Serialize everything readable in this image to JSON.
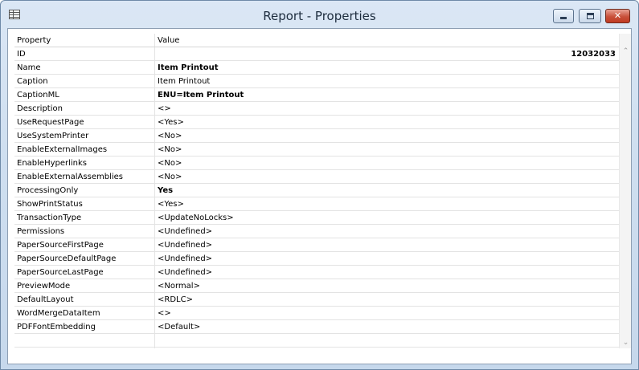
{
  "window": {
    "title": "Report - Properties",
    "minimize_glyph": "",
    "close_glyph": "✕"
  },
  "grid": {
    "headers": {
      "property": "Property",
      "value": "Value"
    },
    "rows": [
      {
        "property": "ID",
        "value": "12032033",
        "bold": true,
        "align": "right"
      },
      {
        "property": "Name",
        "value": "Item Printout",
        "bold": true
      },
      {
        "property": "Caption",
        "value": "Item Printout",
        "bold": false
      },
      {
        "property": "CaptionML",
        "value": "ENU=Item Printout",
        "bold": true
      },
      {
        "property": "Description",
        "value": "<>",
        "bold": false
      },
      {
        "property": "UseRequestPage",
        "value": "<Yes>",
        "bold": false
      },
      {
        "property": "UseSystemPrinter",
        "value": "<No>",
        "bold": false
      },
      {
        "property": "EnableExternalImages",
        "value": "<No>",
        "bold": false
      },
      {
        "property": "EnableHyperlinks",
        "value": "<No>",
        "bold": false
      },
      {
        "property": "EnableExternalAssemblies",
        "value": "<No>",
        "bold": false
      },
      {
        "property": "ProcessingOnly",
        "value": "Yes",
        "bold": true
      },
      {
        "property": "ShowPrintStatus",
        "value": "<Yes>",
        "bold": false
      },
      {
        "property": "TransactionType",
        "value": "<UpdateNoLocks>",
        "bold": false
      },
      {
        "property": "Permissions",
        "value": "<Undefined>",
        "bold": false
      },
      {
        "property": "PaperSourceFirstPage",
        "value": "<Undefined>",
        "bold": false
      },
      {
        "property": "PaperSourceDefaultPage",
        "value": "<Undefined>",
        "bold": false
      },
      {
        "property": "PaperSourceLastPage",
        "value": "<Undefined>",
        "bold": false
      },
      {
        "property": "PreviewMode",
        "value": "<Normal>",
        "bold": false
      },
      {
        "property": "DefaultLayout",
        "value": "<RDLC>",
        "bold": false
      },
      {
        "property": "WordMergeDataItem",
        "value": "<>",
        "bold": false
      },
      {
        "property": "PDFFontEmbedding",
        "value": "<Default>",
        "bold": false
      },
      {
        "property": "",
        "value": "",
        "bold": false
      }
    ]
  },
  "scrollbar": {
    "up_glyph": "⌃",
    "down_glyph": "⌄"
  }
}
